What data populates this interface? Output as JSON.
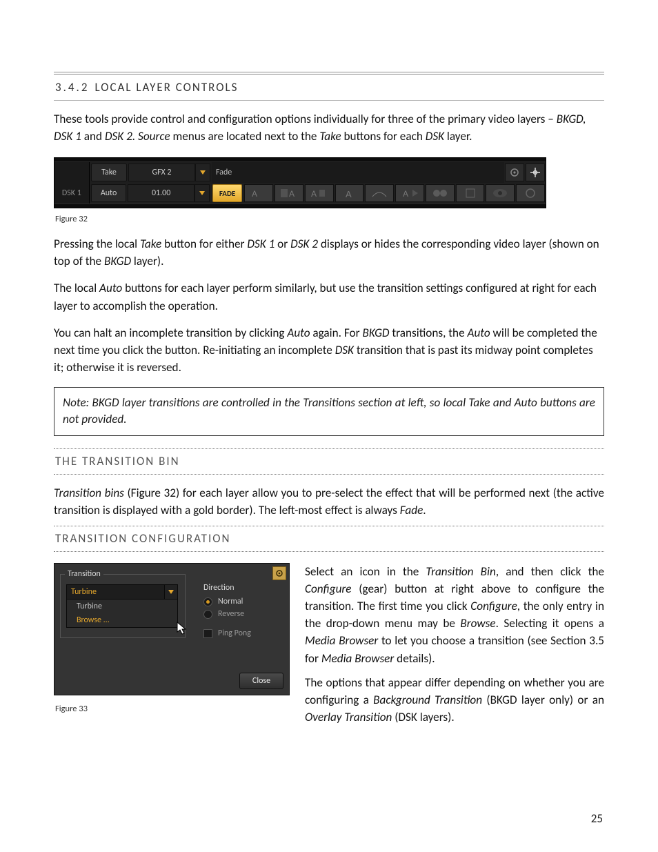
{
  "section": {
    "number": "3.4.2",
    "title": "LOCAL LAYER CONTROLS"
  },
  "para1_a": "These tools provide control and configuration options individually for three of the primary video layers – ",
  "para1_b": "BKGD, DSK 1",
  "para1_c": " and ",
  "para1_d": "DSK 2. Source",
  "para1_e": " menus are located next to the ",
  "para1_f": "Take",
  "para1_g": " buttons for each ",
  "para1_h": "DSK",
  "para1_i": " layer.",
  "fig32": {
    "row1": {
      "take": "Take",
      "source": "GFX 2",
      "fade": "Fade"
    },
    "row2": {
      "layer": "DSK 1",
      "auto": "Auto",
      "duration": "01.00",
      "fade": "FADE"
    }
  },
  "caption32": "Figure 32",
  "para2_a": "Pressing the local ",
  "para2_b": "Take",
  "para2_c": " button for either ",
  "para2_d": "DSK 1",
  "para2_e": " or ",
  "para2_f": "DSK 2",
  "para2_g": " displays or hides the corresponding video layer (shown on top of the ",
  "para2_h": "BKGD",
  "para2_i": " layer).",
  "para3_a": "The local ",
  "para3_b": "Auto",
  "para3_c": " buttons for each layer perform similarly, but use the transition settings configured at right for each layer to accomplish the operation.",
  "para4_a": "You can halt an incomplete transition by clicking ",
  "para4_b": "Auto",
  "para4_c": " again. For ",
  "para4_d": "BKGD",
  "para4_e": " transitions, the ",
  "para4_f": "Auto",
  "para4_g": " will be completed the next time you click the button. Re-initiating an incomplete ",
  "para4_h": "DSK",
  "para4_i": " transition that is past its midway point completes it; otherwise it is reversed.",
  "note": "Note: BKGD layer transitions are controlled in the Transitions section at left, so local Take and Auto buttons are not provided.",
  "h_bin": "THE TRANSITION BIN",
  "para5_a": "Transition bins",
  "para5_b": " (Figure 32) for each layer allow you to pre-select the effect that will be performed next (the active transition is displayed with a gold border).  The left-most effect is always ",
  "para5_c": "Fade",
  "para5_d": ".",
  "h_cfg": "TRANSITION CONFIGURATION",
  "fig33": {
    "legend": "Transition",
    "selected": "Turbine",
    "menu_item1": "Turbine",
    "menu_item2": "Browse ...",
    "dir_title": "Direction",
    "opt_normal": "Normal",
    "opt_reverse": "Reverse",
    "opt_pingpong": "Ping Pong",
    "close": "Close"
  },
  "caption33": "Figure 33",
  "para6_a": "Select an icon in the ",
  "para6_b": "Transition Bin",
  "para6_c": ", and then click the ",
  "para6_d": "Configure",
  "para6_e": " (gear) button at right above to configure the transition.  The first time you click ",
  "para6_f": "Configure",
  "para6_g": ", the only entry in the drop-down menu may be ",
  "para6_h": "Browse",
  "para6_i": ".  Selecting it opens a ",
  "para6_j": "Media Browser",
  "para6_k": " to let you choose a transition (see Section 3.5 for ",
  "para6_l": "Media Browser",
  "para6_m": " details).",
  "para7_a": "The options that appear differ depending on whether you are configuring a ",
  "para7_b": "Background Transition",
  "para7_c": " (BKGD layer only) or an ",
  "para7_d": "Overlay Transition",
  "para7_e": " (DSK layers).",
  "page_number": "25"
}
